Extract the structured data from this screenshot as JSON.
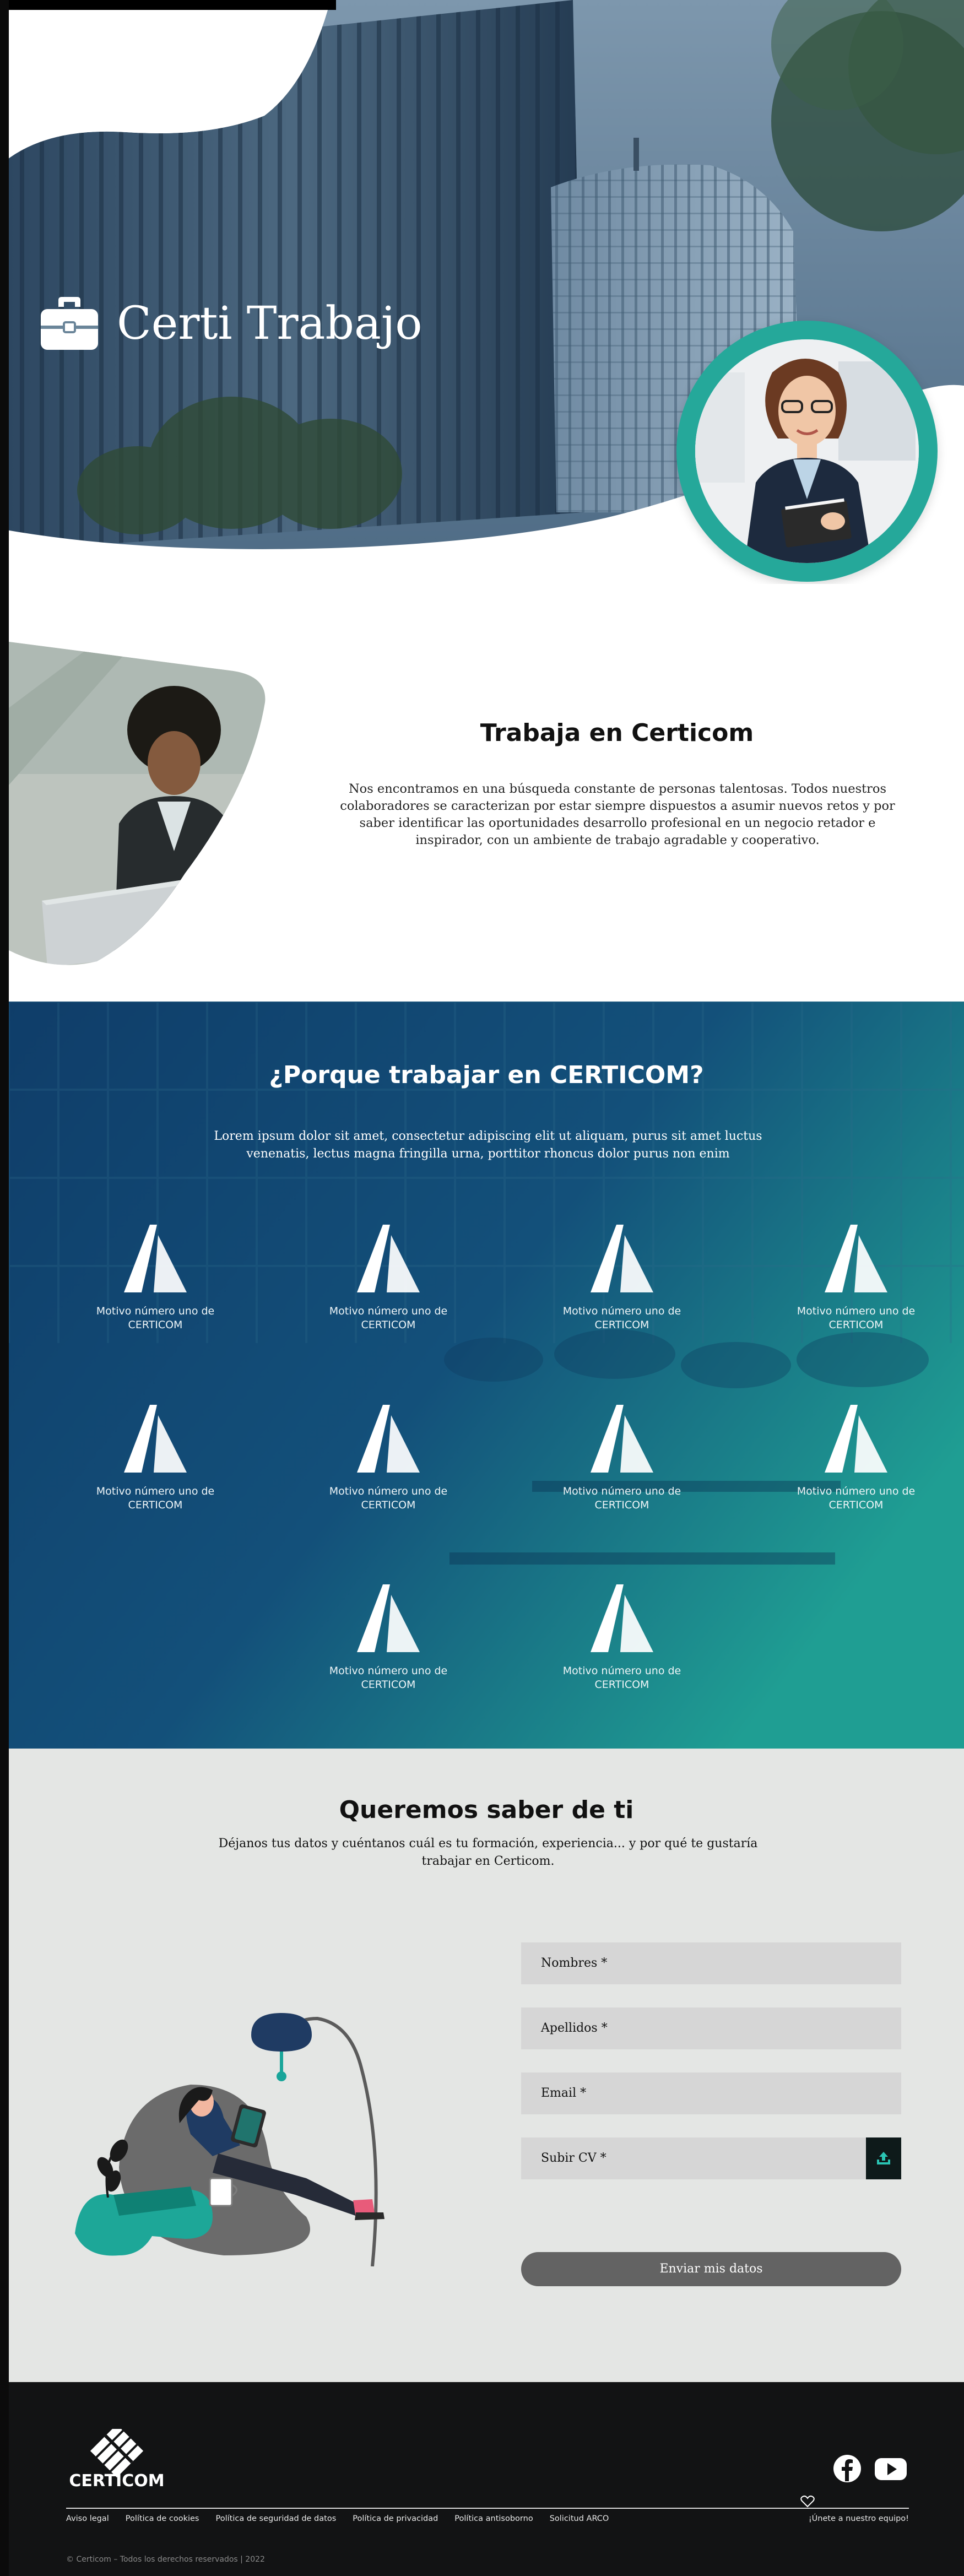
{
  "hero": {
    "title": "Certi Trabajo",
    "title_icon": "briefcase-icon",
    "sky_color": "#6f8aa3",
    "accent_ring": "#25a89a"
  },
  "trabaja": {
    "heading": "Trabaja en Certicom",
    "body": "Nos encontramos en una búsqueda constante de personas talentosas. Todos nuestros colaboradores se caracterizan por estar siempre dispuestos a asumir nuevos retos y por saber identificar las oportunidades desarrollo profesional en un negocio retador e inspirador, con un ambiente de trabajo agradable y cooperativo."
  },
  "porque": {
    "heading": "¿Porque trabajar en CERTICOM?",
    "lead": "Lorem ipsum dolor sit amet, consectetur adipiscing elit ut aliquam, purus sit amet luctus venenatis, lectus magna fringilla urna, porttitor rhoncus dolor purus non enim",
    "gradient": [
      "#11406a",
      "#1e9c92"
    ],
    "motives": [
      {
        "label": "Motivo número uno de CERTICOM",
        "icon": "certicom-mark-icon"
      },
      {
        "label": "Motivo número uno de CERTICOM",
        "icon": "certicom-mark-icon"
      },
      {
        "label": "Motivo número uno de CERTICOM",
        "icon": "certicom-mark-icon"
      },
      {
        "label": "Motivo número uno de CERTICOM",
        "icon": "certicom-mark-icon"
      },
      {
        "label": "Motivo número uno de CERTICOM",
        "icon": "certicom-mark-icon"
      },
      {
        "label": "Motivo número uno de CERTICOM",
        "icon": "certicom-mark-icon"
      },
      {
        "label": "Motivo número uno de CERTICOM",
        "icon": "certicom-mark-icon"
      },
      {
        "label": "Motivo número uno de CERTICOM",
        "icon": "certicom-mark-icon"
      },
      {
        "label": "Motivo número uno de CERTICOM",
        "icon": "certicom-mark-icon"
      },
      {
        "label": "Motivo número uno de CERTICOM",
        "icon": "certicom-mark-icon"
      }
    ]
  },
  "queremos": {
    "heading": "Queremos saber de ti",
    "subtitle": "Déjanos tus datos y cuéntanos cuál es tu formación, experiencia... y por qué te gustaría trabajar en Certicom.",
    "form": {
      "nombres_placeholder": "Nombres *",
      "apellidos_placeholder": "Apellidos *",
      "email_placeholder": "Email *",
      "cv_placeholder": "Subir CV *",
      "upload_icon": "upload-icon",
      "submit_label": "Enviar mis datos"
    },
    "bg_color": "#e4e6e4"
  },
  "footer": {
    "brand": "CERTICOM",
    "links": [
      "Aviso legal",
      "Política de cookies",
      "Política de seguridad de datos",
      "Política de privacidad",
      "Política antisoborno",
      "Solicitud ARCO"
    ],
    "join": "¡Únete a nuestro equipo!",
    "copyright": "© Certicom – Todos los derechos reservados | 2022",
    "social_icons": [
      "facebook-icon",
      "youtube-icon"
    ],
    "bg_color": "#121314"
  }
}
